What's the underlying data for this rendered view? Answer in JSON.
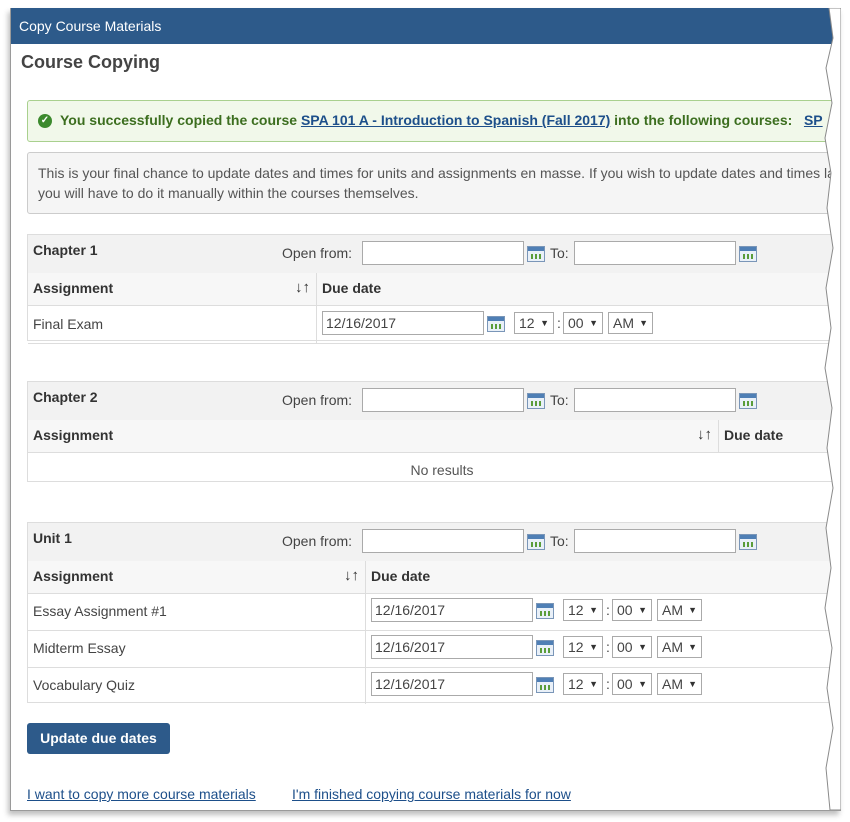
{
  "window": {
    "title": "Copy Course Materials"
  },
  "page": {
    "heading": "Course Copying"
  },
  "success": {
    "prefix": "You successfully copied the course ",
    "course_link": "SPA 101 A - Introduction to Spanish (Fall 2017)",
    "middle": " into the following courses:",
    "target_link": "SP"
  },
  "info": {
    "text": "This is your final chance to update dates and times for units and assignments en masse. If you wish to update dates and times later, you will have to do it manually within the courses themselves."
  },
  "labels": {
    "open_from": "Open from:",
    "to": "To:",
    "assignment": "Assignment",
    "due_date": "Due date",
    "no_results": "No results",
    "sort_glyph": "↓↑"
  },
  "sections": [
    {
      "name": "Chapter 1",
      "open_from": "",
      "to": "",
      "assignments": [
        {
          "name": "Final Exam",
          "date": "12/16/2017",
          "hour": "12",
          "minute": "00",
          "ampm": "AM"
        }
      ]
    },
    {
      "name": "Chapter 2",
      "open_from": "",
      "to": "",
      "assignments": []
    },
    {
      "name": "Unit 1",
      "open_from": "",
      "to": "",
      "assignments": [
        {
          "name": "Essay Assignment #1",
          "date": "12/16/2017",
          "hour": "12",
          "minute": "00",
          "ampm": "AM"
        },
        {
          "name": "Midterm Essay",
          "date": "12/16/2017",
          "hour": "12",
          "minute": "00",
          "ampm": "AM"
        },
        {
          "name": "Vocabulary Quiz",
          "date": "12/16/2017",
          "hour": "12",
          "minute": "00",
          "ampm": "AM"
        }
      ]
    }
  ],
  "buttons": {
    "update": "Update due dates"
  },
  "links": {
    "copy_more": "I want to copy more course materials",
    "finished": "I'm finished copying course materials for now"
  },
  "colors": {
    "titlebar": "#2d5a8a",
    "success_text": "#3c6e1f",
    "link": "#1d4f8a"
  }
}
